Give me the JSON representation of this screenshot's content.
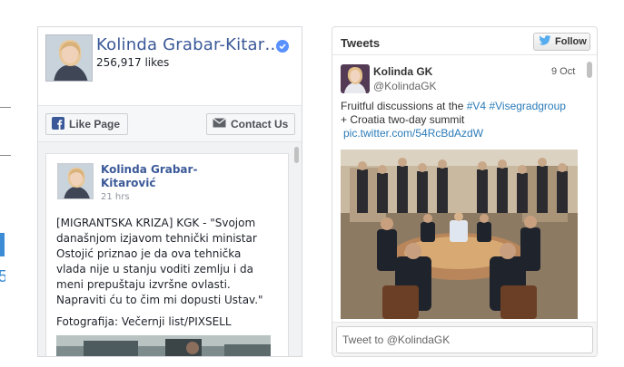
{
  "colors": {
    "facebook_link": "#3b5998",
    "twitter_link": "#2b7bb9",
    "verified_badge": "#5890ff",
    "left_edge_accent": "#3b8bd6"
  },
  "left_edge": {
    "glyph": "5"
  },
  "facebook": {
    "page_name": "Kolinda Grabar-Kitar…",
    "likes": "256,917 likes",
    "verified_icon": "verified-check-icon",
    "like_page_label": "Like Page",
    "like_page_icon": "facebook-f-icon",
    "contact_label": "Contact Us",
    "contact_icon": "envelope-icon",
    "post": {
      "author_line1": "Kolinda Grabar-",
      "author_line2": "Kitarović",
      "time": "21 hrs",
      "text_lines": [
        "[MIGRANTSKA KRIZA] KGK - \"Svojom",
        "današnjom izjavom tehnički ministar",
        "Ostojić priznao je da ova tehnička",
        "vlada nije u stanju voditi zemlju i da",
        "meni prepuštaju izvršne ovlasti.",
        "Napraviti ću to čim mi dopusti Ustav.\""
      ],
      "photo_credit": "Fotografija: Večernji list/PIXSELL"
    }
  },
  "twitter": {
    "widget_title": "Tweets",
    "follow_label": "Follow",
    "follow_icon": "twitter-bird-icon",
    "tweet": {
      "name": "Kolinda GK",
      "handle": "@KolindaGK",
      "date": "9 Oct",
      "text_before": "Fruitful discussions at the ",
      "hashtag1": "#V4",
      "text_space": " ",
      "hashtag2": "#Visegradgroup",
      "text_line2": "+ Croatia two-day summit",
      "link": "pic.twitter.com/54RcBdAzdW"
    },
    "tweet_box_placeholder": "Tweet to @KolindaGK"
  }
}
